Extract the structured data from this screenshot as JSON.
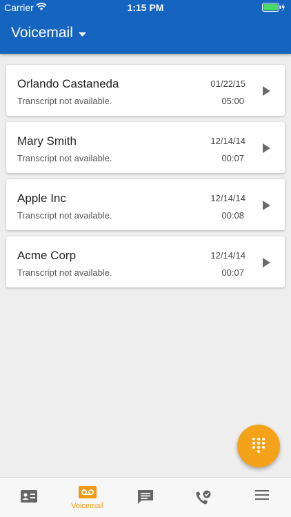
{
  "status_bar": {
    "carrier": "Carrier",
    "time": "1:15 PM",
    "wifi_icon": "wifi-icon",
    "battery_icon": "battery-charging-icon"
  },
  "header": {
    "title": "Voicemail",
    "dropdown_icon": "caret-down-icon",
    "background_color": "#1565c0"
  },
  "voicemails": [
    {
      "name": "Orlando Castaneda",
      "transcript": "Transcript not available.",
      "date": "01/22/15",
      "duration": "05:00"
    },
    {
      "name": "Mary Smith",
      "transcript": "Transcript not available.",
      "date": "12/14/14",
      "duration": "00:07"
    },
    {
      "name": "Apple Inc",
      "transcript": "Transcript not available.",
      "date": "12/14/14",
      "duration": "00:08"
    },
    {
      "name": "Acme Corp",
      "transcript": "Transcript not available.",
      "date": "12/14/14",
      "duration": "00:07"
    }
  ],
  "fab": {
    "icon": "dialpad-icon",
    "color": "#f5a21b"
  },
  "bottom_nav": {
    "active_color": "#f29a11",
    "items": [
      {
        "icon": "contacts-card-icon",
        "label": ""
      },
      {
        "icon": "voicemail-icon",
        "label": "Voicemail",
        "active": true
      },
      {
        "icon": "message-icon",
        "label": ""
      },
      {
        "icon": "call-history-icon",
        "label": ""
      },
      {
        "icon": "menu-icon",
        "label": ""
      }
    ]
  }
}
